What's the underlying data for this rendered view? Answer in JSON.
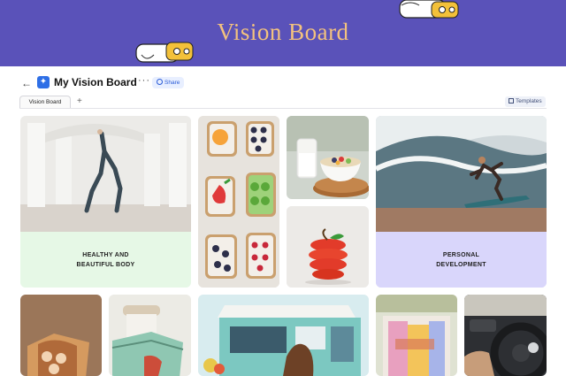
{
  "banner": {
    "title": "Vision Board",
    "color": "#5a52b9",
    "title_color": "#f3c27e"
  },
  "toolbar": {
    "back_label": "←",
    "board_title": "My Vision Board",
    "more_label": "···",
    "share_label": "Share",
    "templates_label": "Templates"
  },
  "tabs": [
    {
      "label": "Vision Board"
    }
  ],
  "tab_add_label": "+",
  "cards": {
    "yoga": {
      "caption_line1": "HEALTHY AND",
      "caption_line2": "BEAUTIFUL BODY",
      "caption_color": "#e6f8e6"
    },
    "surf": {
      "caption_line1": "PERSONAL",
      "caption_line2": "DEVELOPMENT",
      "caption_color": "#d9d6fb"
    }
  }
}
